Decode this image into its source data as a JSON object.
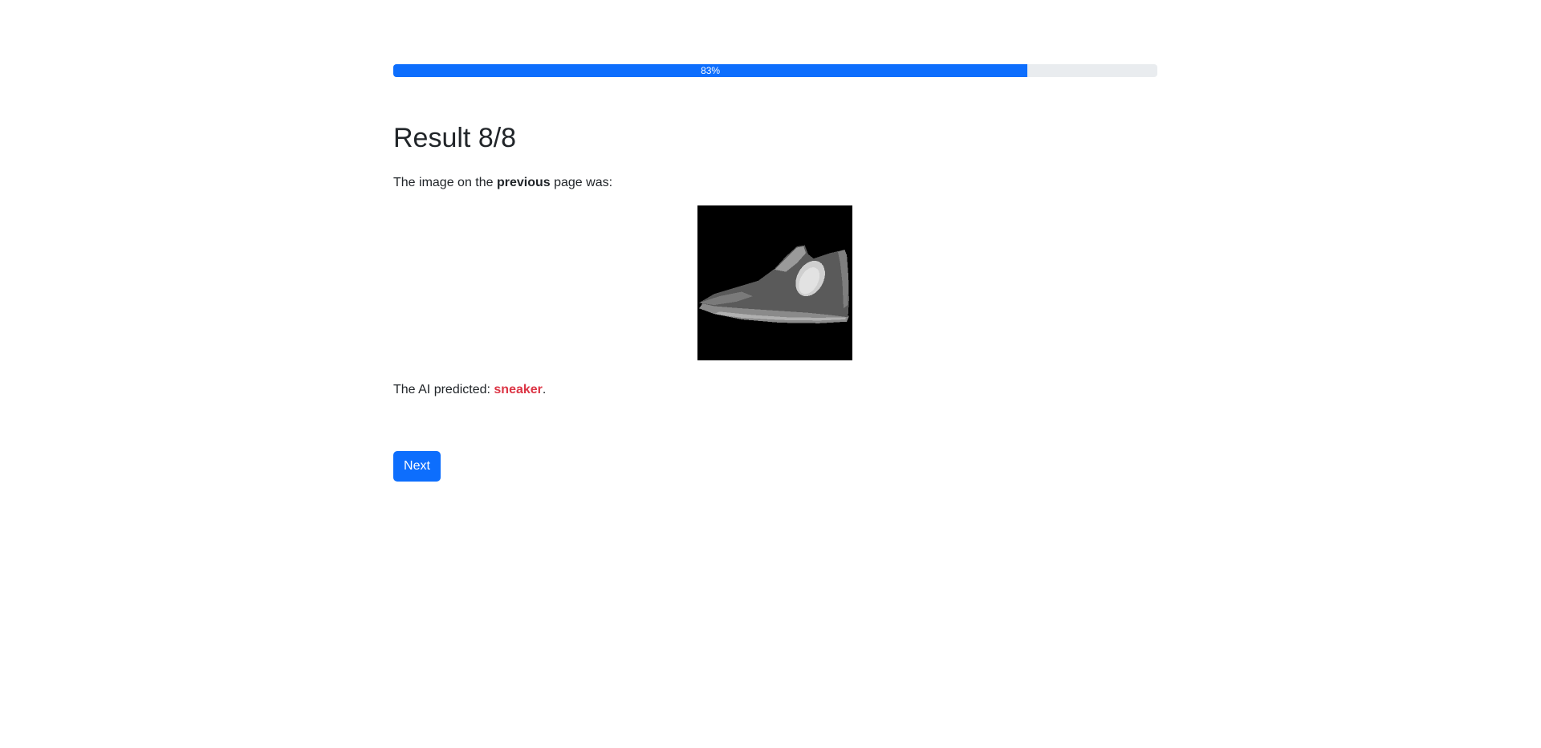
{
  "progress": {
    "value_percent": 83,
    "label": "83%",
    "fill_color": "#0d6efd",
    "track_color": "#e9ecef"
  },
  "result": {
    "title": "Result 8/8",
    "intro_prefix": "The image on the ",
    "intro_bold": "previous",
    "intro_suffix": " page was:",
    "image_icon": "sneaker-image",
    "prediction_prefix": "The AI predicted: ",
    "prediction_label": "sneaker",
    "prediction_suffix": ".",
    "prediction_color": "#dc3545"
  },
  "actions": {
    "next_label": "Next",
    "next_color": "#0d6efd"
  }
}
